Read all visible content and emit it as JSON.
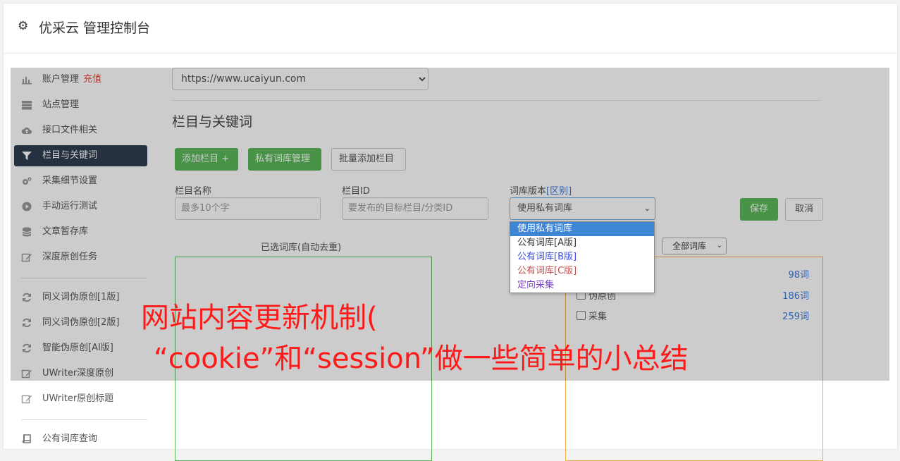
{
  "header": {
    "title": "优采云 管理控制台",
    "icon": "gear-icon"
  },
  "sidebar": {
    "items": [
      {
        "label": "账户管理",
        "extra": "充值",
        "icon": "bar-chart-icon",
        "active": false
      },
      {
        "label": "站点管理",
        "icon": "server-icon",
        "active": false
      },
      {
        "label": "接口文件相关",
        "icon": "cloud-upload-icon",
        "active": false
      },
      {
        "label": "栏目与关键词",
        "icon": "filter-icon",
        "active": true
      },
      {
        "label": "采集细节设置",
        "icon": "cogs-icon",
        "active": false
      },
      {
        "label": "手动运行测试",
        "icon": "play-circle-icon",
        "active": false
      },
      {
        "label": "文章暂存库",
        "icon": "database-icon",
        "active": false
      },
      {
        "label": "深度原创任务",
        "icon": "edit-icon",
        "active": false
      },
      {
        "label": "同义词伪原创[1版]",
        "icon": "refresh-icon",
        "active": false
      },
      {
        "label": "同义词伪原创[2版]",
        "icon": "refresh-icon",
        "active": false
      },
      {
        "label": "智能伪原创[AI版]",
        "icon": "refresh-icon",
        "active": false
      },
      {
        "label": "UWriter深度原创",
        "icon": "edit-icon",
        "active": false
      },
      {
        "label": "UWriter原创标题",
        "icon": "edit-icon",
        "active": false
      },
      {
        "label": "公有词库查询",
        "icon": "book-icon",
        "active": false
      }
    ]
  },
  "main": {
    "site_select": "https://www.ucaiyun.com",
    "section_title": "栏目与关键词",
    "buttons": {
      "add_column": "添加栏目 +",
      "private_lib": "私有词库管理",
      "batch_add": "批量添加栏目",
      "save": "保存",
      "cancel": "取消"
    },
    "form": {
      "column_name_label": "栏目名称",
      "column_name_placeholder": "最多10个字",
      "column_id_label": "栏目ID",
      "column_id_placeholder": "要发布的目标栏目/分类ID",
      "lib_version_label": "词库版本",
      "lib_version_link": "[区别]",
      "lib_version_value": "使用私有词库"
    },
    "dropdown_options": [
      {
        "label": "使用私有词库",
        "color": "#ffffff",
        "selected": true
      },
      {
        "label": "公有词库[A版]",
        "color": "#333333",
        "selected": false
      },
      {
        "label": "公有词库[B版]",
        "color": "#3b4fd8",
        "selected": false
      },
      {
        "label": "公有词库[C版]",
        "color": "#c0504d",
        "selected": false
      },
      {
        "label": "定向采集",
        "color": "#7a3fc4",
        "selected": false
      }
    ],
    "selected_lib_title": "已选词库(自动去重)",
    "all_libs_select": "全部词库",
    "libs": [
      {
        "label": "",
        "count": "98词"
      },
      {
        "label": "伪原创",
        "count": "186词"
      },
      {
        "label": "采集",
        "count": "259词"
      }
    ]
  },
  "caption": {
    "line1": "网站内容更新机制(",
    "line2": "“cookie”和“session”做一些简单的小总结"
  },
  "colors": {
    "accent_green": "#5cb85c",
    "nav_active": "#2f3d52",
    "recharge_red": "#e74c3c",
    "caption_red": "#ff1a1a"
  }
}
